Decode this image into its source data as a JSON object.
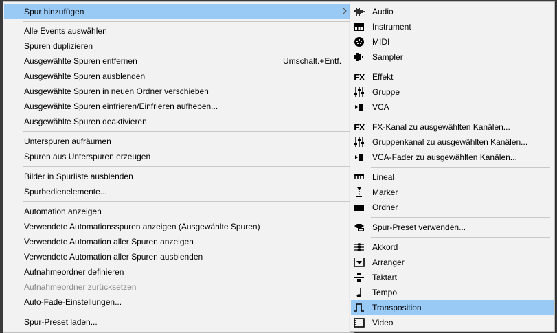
{
  "main_menu": {
    "add_track": "Spur hinzufügen",
    "items": [
      "Alle Events auswählen",
      "Spuren duplizieren",
      "Ausgewählte Spuren entfernen",
      "Ausgewählte Spuren ausblenden",
      "Ausgewählte Spuren in neuen Ordner verschieben",
      "Ausgewählte Spuren einfrieren/Einfrieren aufheben...",
      "Ausgewählte Spuren deaktivieren",
      "Unterspuren aufräumen",
      "Spuren aus Unterspuren erzeugen",
      "Bilder in Spurliste ausblenden",
      "Spurbedienelemente...",
      "Automation anzeigen",
      "Verwendete Automationsspuren anzeigen (Ausgewählte Spuren)",
      "Verwendete Automation aller Spuren anzeigen",
      "Verwendete Automation aller Spuren ausblenden",
      "Aufnahmeordner definieren",
      "Aufnahmeordner zurücksetzen",
      "Auto-Fade-Einstellungen...",
      "Spur-Preset laden..."
    ],
    "remove_shortcut": "Umschalt.+Entf.",
    "disabled_item": "Aufnahmeordner zurücksetzen"
  },
  "submenu": {
    "items": [
      {
        "label": "Audio",
        "icon": "audio-waveform-icon"
      },
      {
        "label": "Instrument",
        "icon": "piano-keys-icon"
      },
      {
        "label": "MIDI",
        "icon": "midi-connector-icon"
      },
      {
        "label": "Sampler",
        "icon": "sampler-icon"
      },
      {
        "label": "Effekt",
        "icon": "fx-icon",
        "glyph": "FX"
      },
      {
        "label": "Gruppe",
        "icon": "group-faders-icon"
      },
      {
        "label": "VCA",
        "icon": "vca-fader-icon"
      },
      {
        "label": "FX-Kanal zu ausgewählten Kanälen...",
        "icon": "fx-icon",
        "glyph": "FX"
      },
      {
        "label": "Gruppenkanal zu ausgewählten Kanälen...",
        "icon": "group-faders-icon"
      },
      {
        "label": "VCA-Fader zu ausgewählten Kanälen...",
        "icon": "vca-fader-icon"
      },
      {
        "label": "Lineal",
        "icon": "ruler-icon"
      },
      {
        "label": "Marker",
        "icon": "marker-icon"
      },
      {
        "label": "Ordner",
        "icon": "folder-icon"
      },
      {
        "label": "Spur-Preset verwenden...",
        "icon": "track-preset-icon"
      },
      {
        "label": "Akkord",
        "icon": "chord-icon"
      },
      {
        "label": "Arranger",
        "icon": "arranger-icon"
      },
      {
        "label": "Taktart",
        "icon": "signature-icon"
      },
      {
        "label": "Tempo",
        "icon": "tempo-note-icon"
      },
      {
        "label": "Transposition",
        "icon": "transpose-icon"
      },
      {
        "label": "Video",
        "icon": "video-icon"
      }
    ],
    "highlighted": "Transposition"
  },
  "colors": {
    "highlight": "#99c9f5",
    "menu_bg": "#f2f2f2",
    "disabled_text": "#8a8a8a"
  }
}
